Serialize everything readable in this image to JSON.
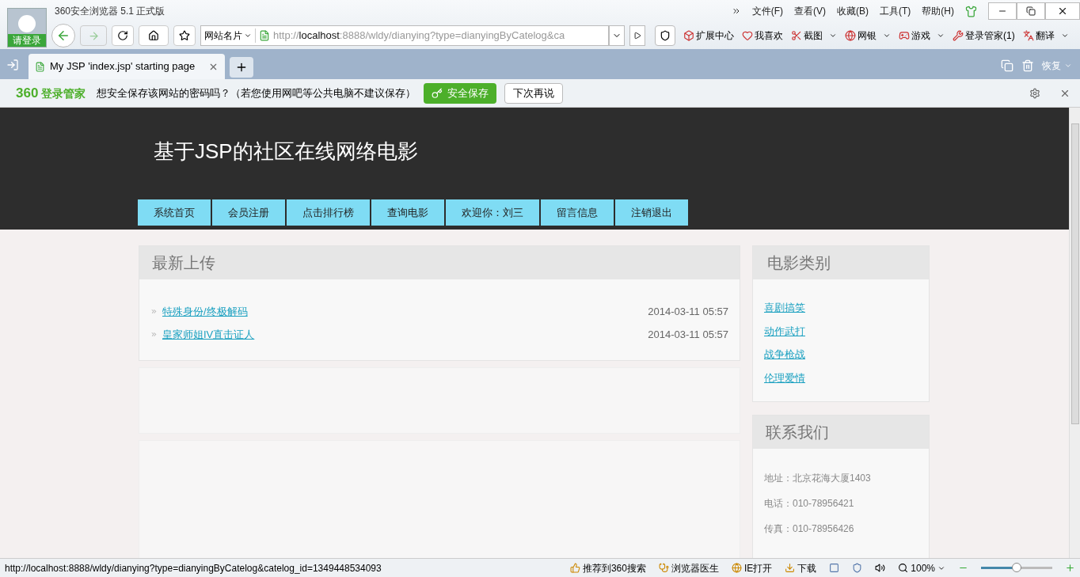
{
  "window": {
    "title": "360安全浏览器 5.1 正式版",
    "login_label": "请登录",
    "menu": [
      "文件(F)",
      "查看(V)",
      "收藏(B)",
      "工具(T)",
      "帮助(H)"
    ]
  },
  "toolbar": {
    "site_card": "网站名片",
    "url_prefix": "http://",
    "url_host": "localhost",
    "url_rest": ":8888/wldy/dianying?type=dianyingByCatelog&ca",
    "extensions": [
      {
        "label": "扩展中心",
        "dropdown": false
      },
      {
        "label": "我喜欢",
        "dropdown": false
      },
      {
        "label": "截图",
        "dropdown": true
      },
      {
        "label": "网银",
        "dropdown": true
      },
      {
        "label": "游戏",
        "dropdown": true
      },
      {
        "label": "登录管家(1)",
        "dropdown": false
      },
      {
        "label": "翻译",
        "dropdown": true
      }
    ]
  },
  "tabs": [
    {
      "label": "My JSP 'index.jsp' starting page",
      "selected": true
    }
  ],
  "tab_bar": {
    "restore": "恢复"
  },
  "password_bar": {
    "brand": "360",
    "brand_name": "登录管家",
    "message": "想安全保存该网站的密码吗？（若您使用网吧等公共电脑不建议保存）",
    "save": "安全保存",
    "later": "下次再说"
  },
  "page": {
    "site_title": "基于JSP的社区在线网络电影",
    "nav": [
      {
        "label": "系统首页"
      },
      {
        "label": "会员注册"
      },
      {
        "label": "点击排行榜"
      },
      {
        "label": "查询电影"
      },
      {
        "label": "欢迎你：刘三"
      },
      {
        "label": "留言信息"
      },
      {
        "label": "注销退出"
      }
    ],
    "latest": {
      "title": "最新上传",
      "items": [
        {
          "title": "特殊身份/终极解码",
          "date": "2014-03-11 05:57"
        },
        {
          "title": "皇家师姐IV直击证人",
          "date": "2014-03-11 05:57"
        }
      ]
    },
    "categories": {
      "title": "电影类别",
      "items": [
        "喜剧搞笑",
        "动作武打",
        "战争枪战",
        "伦理爱情"
      ]
    },
    "contact": {
      "title": "联系我们",
      "lines": [
        "地址：北京花海大厦1403",
        "电话：010-78956421",
        "传真：010-78956426"
      ]
    }
  },
  "status_bar": {
    "url": "http://localhost:8888/wldy/dianying?type=dianyingByCatelog&catelog_id=1349448534093",
    "items": [
      "推荐到360搜索",
      "浏览器医生",
      "IE打开",
      "下载"
    ],
    "zoom": "100%",
    "zoom_level": {
      "level": 0.5
    }
  }
}
